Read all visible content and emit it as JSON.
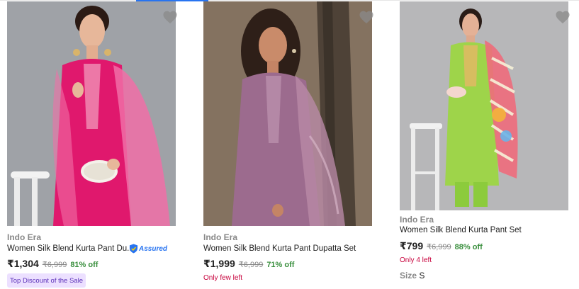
{
  "products": [
    {
      "brand": "Indo Era",
      "title": "Women Silk Blend Kurta Pant Du...",
      "price": "₹1,304",
      "mrp": "₹6,999",
      "discount": "81% off",
      "assured_label": "Assured",
      "promo_badge": "Top Discount of the Sale",
      "image_colors": {
        "background": "#9b9ea3",
        "outfit": "#e0186d",
        "dupatta": "#f06fa7"
      },
      "heart_icon": "heart-icon"
    },
    {
      "brand": "Indo Era",
      "title": "Women Silk Blend Kurta Pant Dupatta Set",
      "price": "₹1,999",
      "mrp": "₹6,999",
      "discount": "71% off",
      "stock_note": "Only few left",
      "image_colors": {
        "background": "#7a6a5a",
        "outfit": "#9c6b8e",
        "dupatta": "#b98aa6"
      },
      "heart_icon": "heart-icon"
    },
    {
      "brand": "Indo Era",
      "title": "Women Silk Blend Kurta Pant Set",
      "price": "₹799",
      "mrp": "₹6,999",
      "discount": "88% off",
      "stock_note": "Only 4 left",
      "size_label": "Size",
      "size_value": "S",
      "image_colors": {
        "background": "#b7b7b9",
        "outfit": "#9ed44a",
        "dupatta": "#ee6c7c"
      },
      "heart_icon": "heart-icon"
    }
  ],
  "colors": {
    "price_text": "#212121",
    "muted_text": "#878787",
    "discount_green": "#388e3c",
    "stock_red": "#c7003b",
    "promo_bg": "#ece0ff",
    "assured_blue": "#2874f0"
  }
}
